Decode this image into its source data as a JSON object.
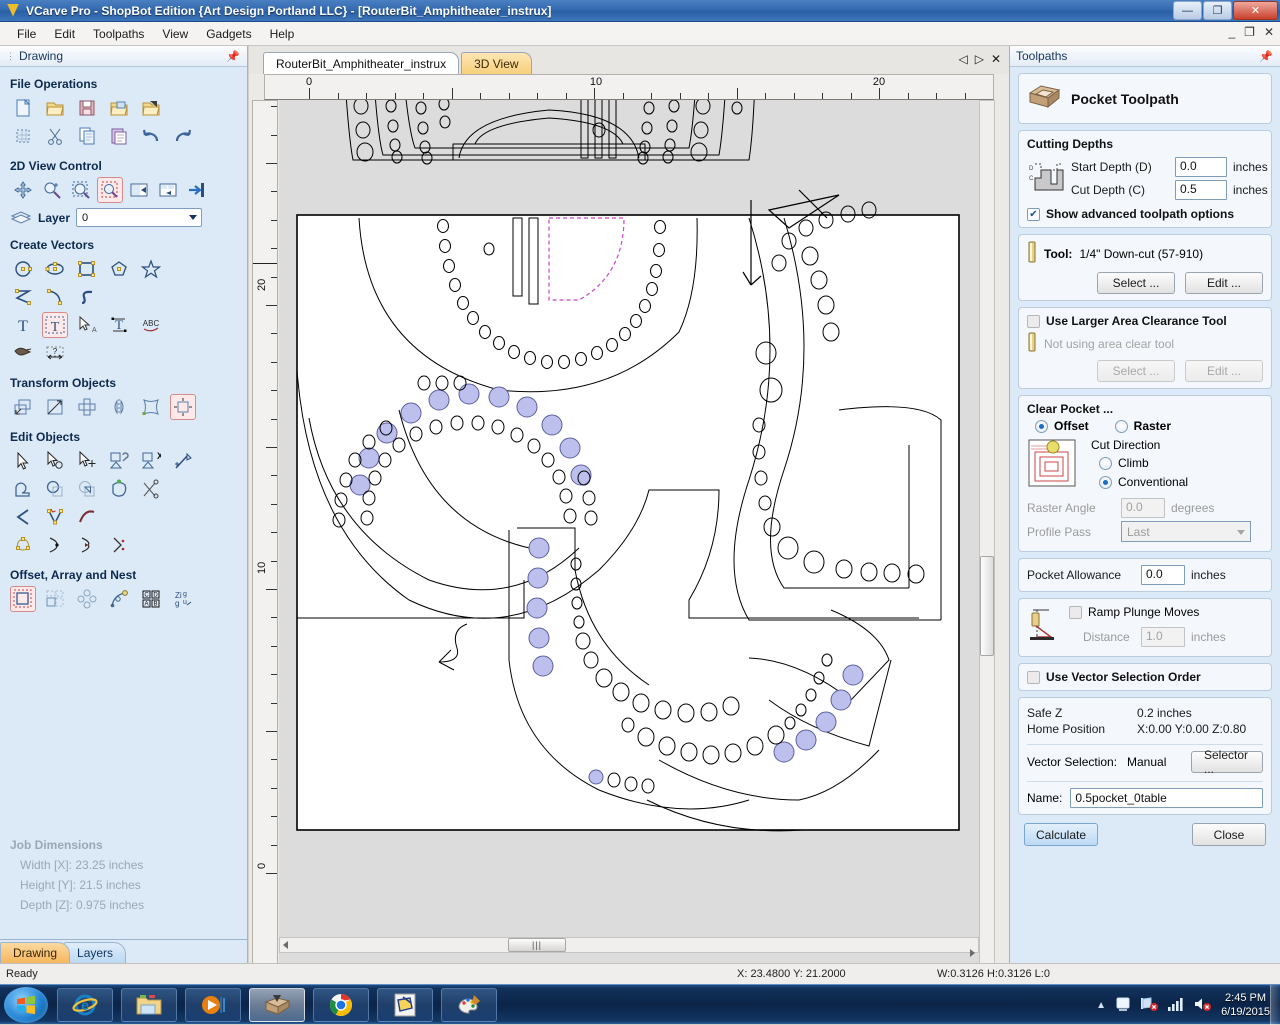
{
  "window": {
    "title": "VCarve Pro - ShopBot Edition {Art Design Portland LLC} - [RouterBit_Amphitheater_instrux]",
    "app_icon": "vcarve-logo-icon",
    "minimize": "—",
    "maximize": "❐",
    "close": "✕",
    "inner_minimize": "_",
    "inner_restore": "❐",
    "inner_close": "✕"
  },
  "menu": {
    "items": [
      "File",
      "Edit",
      "Toolpaths",
      "View",
      "Gadgets",
      "Help"
    ]
  },
  "left_panel": {
    "header": {
      "title": "Drawing",
      "pin_icon": "pin-icon"
    },
    "groups": [
      {
        "title": "File Operations",
        "rows": [
          [
            "new-file-icon",
            "open-file-icon",
            "save-file-icon",
            "open-recent-icon",
            "import-file-icon"
          ],
          [
            "select-all-icon",
            "cut-icon",
            "copy-icon",
            "paste-icon",
            "undo-icon",
            "redo-icon"
          ]
        ]
      },
      {
        "title": "2D View Control",
        "rows": [
          [
            "pan-icon",
            "zoom-in-icon",
            "zoom-selected-icon",
            "zoom-box-icon",
            "zoom-drawing-icon",
            "zoom-job-icon",
            "toggle-panel-icon"
          ]
        ]
      },
      {
        "title": "Create Vectors",
        "rows": [
          [
            "circle-icon",
            "ellipse-icon",
            "rectangle-icon",
            "polygon-icon",
            "star-icon"
          ],
          [
            "polyline-icon",
            "arc-icon",
            "curve-icon"
          ],
          [
            "draw-text-icon",
            "edit-text-icon",
            "text-select-icon",
            "text-on-curve-icon",
            "auto-kern-icon"
          ],
          [
            "trace-bitmap-icon",
            "dimension-icon"
          ]
        ]
      },
      {
        "title": "Transform Objects",
        "rows": [
          [
            "move-icon",
            "scale-icon",
            "rotate-icon",
            "mirror-icon",
            "distort-icon",
            "align-icon"
          ]
        ]
      },
      {
        "title": "Edit Objects",
        "rows": [
          [
            "node-edit-icon",
            "select-settings-icon",
            "multi-select-icon",
            "join-vectors-icon",
            "close-vector-icon",
            "measure-icon"
          ],
          [
            "weld-icon",
            "subtract-icon",
            "trim-icon",
            "offset-shape-icon",
            "cut-vector-icon"
          ],
          [
            "fillet-icon",
            "node-tools-icon",
            "smooth-curve-icon"
          ],
          [
            "node-array-icon",
            "start-point-icon",
            "direction-icon",
            "reverse-icon"
          ]
        ]
      },
      {
        "title": "Offset, Array and Nest",
        "rows": [
          [
            "offset-vectors-icon",
            "block-copy-icon",
            "circular-copy-icon",
            "copy-along-curve-icon",
            "plate-layout-icon",
            "nesting-icon"
          ]
        ]
      }
    ],
    "layer": {
      "label": "Layer",
      "value": "0",
      "icon": "layers-icon"
    },
    "job_dimensions": {
      "title": "Job Dimensions",
      "width": "Width  [X]: 23.25 inches",
      "height": "Height [Y]: 21.5 inches",
      "depth": "Depth  [Z]: 0.975 inches"
    },
    "tabs": [
      {
        "label": "Drawing",
        "active": true
      },
      {
        "label": "Layers",
        "active": false
      }
    ]
  },
  "canvas": {
    "tabs": [
      {
        "label": "RouterBit_Amphitheater_instrux",
        "active": true
      },
      {
        "label": "3D View",
        "active": false
      }
    ],
    "nav": {
      "prev": "◁",
      "next": "▷",
      "close": "✕"
    },
    "ruler_top": {
      "labels": [
        "0",
        "10",
        "20"
      ]
    },
    "ruler_left": {
      "labels": [
        "20",
        "10",
        "0"
      ]
    },
    "hscroll_thumb_glyph": "|||"
  },
  "toolpaths": {
    "header": {
      "title": "Toolpaths",
      "pin_icon": "pin-icon"
    },
    "toolpath_type": {
      "label": "Pocket Toolpath",
      "icon": "pocket-toolpath-icon"
    },
    "cutting_depths": {
      "title": "Cutting Depths",
      "icon": "depth-profile-icon",
      "start_depth_label": "Start Depth (D)",
      "start_depth_value": "0.0",
      "start_depth_unit": "inches",
      "cut_depth_label": "Cut Depth (C)",
      "cut_depth_value": "0.5",
      "cut_depth_unit": "inches",
      "advanced_label": "Show advanced toolpath options",
      "advanced_checked": true,
      "check_glyph": "✔"
    },
    "tool": {
      "label": "Tool:",
      "value": "1/4\" Down-cut (57-910)",
      "icon": "endmill-icon",
      "select_button": "Select ...",
      "edit_button": "Edit ..."
    },
    "area_clearance": {
      "checkbox_label": "Use Larger Area Clearance Tool",
      "checked": false,
      "status": "Not using area clear tool",
      "icon": "endmill-icon",
      "select_button": "Select ...",
      "edit_button": "Edit ..."
    },
    "clear_pocket": {
      "title": "Clear Pocket ...",
      "offset_label": "Offset",
      "raster_label": "Raster",
      "mode": "Offset",
      "preview_icon": "offset-pattern-icon",
      "cut_direction_label": "Cut Direction",
      "climb_label": "Climb",
      "conventional_label": "Conventional",
      "cut_direction": "Conventional",
      "raster_angle_label": "Raster Angle",
      "raster_angle_value": "0.0",
      "raster_angle_unit": "degrees",
      "profile_pass_label": "Profile Pass",
      "profile_pass_value": "Last"
    },
    "pocket_allowance": {
      "label": "Pocket Allowance",
      "value": "0.0",
      "unit": "inches"
    },
    "ramp": {
      "icon": "ramp-plunge-icon",
      "checkbox_label": "Ramp Plunge Moves",
      "checked": false,
      "distance_label": "Distance",
      "distance_value": "1.0",
      "distance_unit": "inches"
    },
    "vector_selection_order": {
      "label": "Use Vector Selection Order",
      "checked": false
    },
    "position_info": {
      "safe_z_label": "Safe Z",
      "safe_z_value": "0.2 inches",
      "home_label": "Home Position",
      "home_value": "X:0.00 Y:0.00 Z:0.80"
    },
    "vector_selection": {
      "label": "Vector Selection:",
      "value": "Manual",
      "selector_button": "Selector ..."
    },
    "name": {
      "label": "Name:",
      "value": "0.5pocket_0table"
    },
    "actions": {
      "calculate": "Calculate",
      "close": "Close"
    }
  },
  "statusbar": {
    "ready": "Ready",
    "coords": "X: 23.4800 Y: 21.2000",
    "dims": "W:0.3126  H:0.3126  L:0"
  },
  "taskbar": {
    "start_icon": "windows-start-icon",
    "buttons": [
      {
        "icon": "internet-explorer-icon",
        "active": false
      },
      {
        "icon": "file-explorer-icon",
        "active": false
      },
      {
        "icon": "media-player-icon",
        "active": false
      },
      {
        "icon": "vcarve-pro-icon",
        "active": true
      },
      {
        "icon": "google-chrome-icon",
        "active": false
      },
      {
        "icon": "editor-app-icon",
        "active": false
      },
      {
        "icon": "paint-icon",
        "active": false
      }
    ],
    "tray": {
      "show_hidden_icon": "chevron-up-icon",
      "action_center_icon": "action-center-icon",
      "network_icon": "network-error-icon",
      "signal_icon": "signal-bars-icon",
      "volume_icon": "volume-muted-icon",
      "time": "2:45 PM",
      "date": "6/19/2015"
    }
  },
  "colors": {
    "title_blue": "#346ab0",
    "panel_blue": "#dce9f7",
    "accent_orange": "#f6b75e",
    "selected_fill": "#b9bcea",
    "magenta_dash": "#cc44cc"
  }
}
